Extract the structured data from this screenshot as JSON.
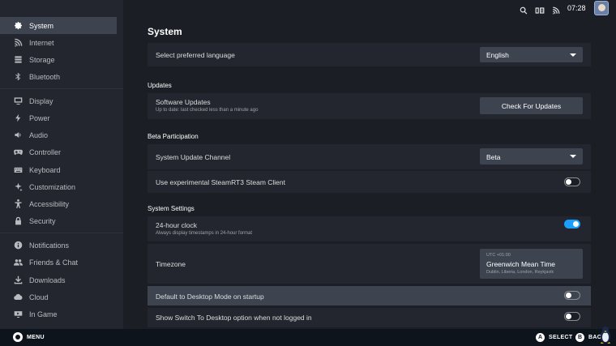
{
  "sidebar": {
    "items": [
      {
        "label": "System",
        "icon": "gear-icon",
        "active": true
      },
      {
        "label": "Internet",
        "icon": "wifi-icon"
      },
      {
        "label": "Storage",
        "icon": "storage-icon"
      },
      {
        "label": "Bluetooth",
        "icon": "bluetooth-icon"
      },
      {
        "label": "Display",
        "icon": "display-icon"
      },
      {
        "label": "Power",
        "icon": "power-icon"
      },
      {
        "label": "Audio",
        "icon": "speaker-icon"
      },
      {
        "label": "Controller",
        "icon": "gamepad-icon"
      },
      {
        "label": "Keyboard",
        "icon": "keyboard-icon"
      },
      {
        "label": "Customization",
        "icon": "customization-icon"
      },
      {
        "label": "Accessibility",
        "icon": "accessibility-icon"
      },
      {
        "label": "Security",
        "icon": "lock-icon"
      },
      {
        "label": "Notifications",
        "icon": "info-icon"
      },
      {
        "label": "Friends & Chat",
        "icon": "friends-icon"
      },
      {
        "label": "Downloads",
        "icon": "download-icon"
      },
      {
        "label": "Cloud",
        "icon": "cloud-icon"
      },
      {
        "label": "In Game",
        "icon": "in-game-icon"
      }
    ]
  },
  "topbar": {
    "icons": [
      "search-icon",
      "controller-battery-icon",
      "wifi-signal-icon"
    ],
    "time": "07:28"
  },
  "main": {
    "title": "System",
    "language": {
      "label": "Select preferred language",
      "value": "English"
    },
    "updates": {
      "section": "Updates",
      "label": "Software Updates",
      "sub": "Up to date: last checked less than a minute ago",
      "button": "Check For Updates"
    },
    "beta": {
      "section": "Beta Participation",
      "channel_label": "System Update Channel",
      "channel_value": "Beta",
      "experimental_label": "Use experimental SteamRT3 Steam Client",
      "experimental_on": false
    },
    "system_settings": {
      "section": "System Settings",
      "clock_label": "24-hour clock",
      "clock_sub": "Always display timestamps in 24-hour format",
      "clock_on": true,
      "timezone_label": "Timezone",
      "timezone_offset": "UTC +01:00",
      "timezone_value": "Greenwich Mean Time",
      "timezone_cities": "Dublin, Liberia, London, Reykjavik",
      "desktop_mode_label": "Default to Desktop Mode on startup",
      "desktop_mode_on": false,
      "switch_desktop_label": "Show Switch To Desktop option when not logged in",
      "switch_desktop_on": false
    }
  },
  "bottombar": {
    "menu": "MENU",
    "select_key": "A",
    "select": "SELECT",
    "back_key": "B",
    "back": "BAC"
  },
  "colors": {
    "accent": "#1a9fff",
    "sidebar_bg": "#23262e",
    "main_bg": "#1b1e25",
    "row_bg": "#23262e",
    "control_bg": "#3d4450"
  }
}
